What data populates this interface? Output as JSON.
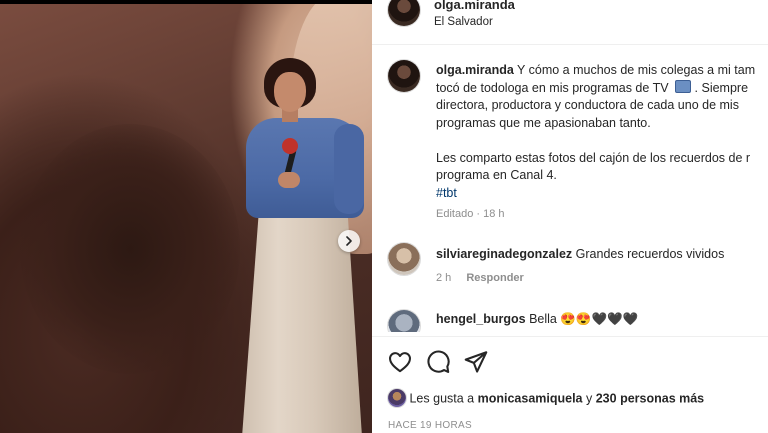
{
  "post": {
    "username": "olga.miranda",
    "location": "El Salvador"
  },
  "caption": {
    "username": "olga.miranda",
    "line1_text": "Y cómo a muchos de mis colegas a mi tam",
    "line2_before": "tocó de todologa en mis programas de TV",
    "line2_after": ". Siempre",
    "line3": "directora, productora y conductora de cada uno de mis",
    "line4": "programas que me apasionaban tanto.",
    "line5": "Les comparto estas fotos del cajón de los recuerdos de r",
    "line6": "programa en Canal 4.",
    "hashtag": "#tbt",
    "meta": "Editado · 18 h"
  },
  "comments": [
    {
      "username": "silviareginadegonzalez",
      "text": "Grandes recuerdos vividos",
      "time": "2 h",
      "reply_label": "Responder"
    },
    {
      "username": "hengel_burgos",
      "text": "Bella 😍😍🖤🖤🖤"
    }
  ],
  "likes": {
    "prefix": "Les gusta a",
    "user": "monicasamiquela",
    "joiner": "y",
    "others": "230 personas más"
  },
  "time_ago": "HACE 19 HORAS",
  "icons": [
    "heart-icon",
    "comment-icon",
    "share-icon",
    "chevron-right-icon",
    "tv-emoji-icon"
  ],
  "colors": {
    "text": "#262626",
    "secondary": "#8e8e8e",
    "link": "#00376b",
    "divider": "#efefef"
  }
}
